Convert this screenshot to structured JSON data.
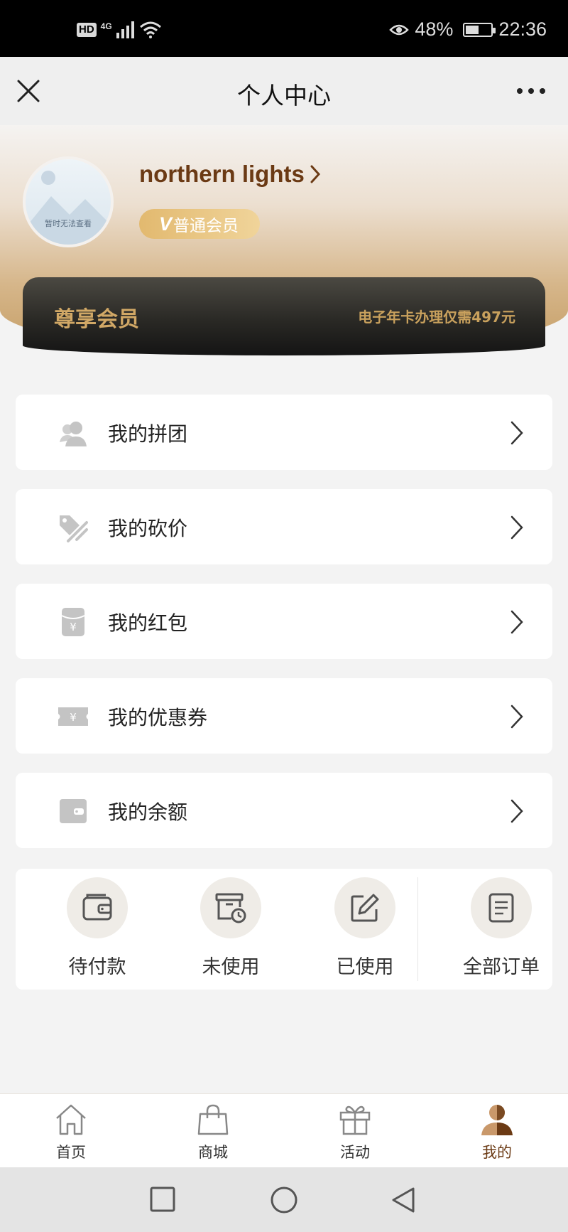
{
  "status_bar": {
    "hd": "HD",
    "network": "4G",
    "battery_percent": "48%",
    "battery_level": 0.48,
    "time": "22:36"
  },
  "nav": {
    "title": "个人中心",
    "close_icon": "close-icon",
    "more_icon": "more-icon"
  },
  "profile": {
    "avatar_placeholder": "暂时无法查看",
    "username": "northern lights",
    "member_level": "普通会员",
    "member_v": "V"
  },
  "vip_card": {
    "title": "尊享会员",
    "desc": "电子年卡办理仅需497元"
  },
  "menu": [
    {
      "label": "我的拼团",
      "icon": "group-user-icon"
    },
    {
      "label": "我的砍价",
      "icon": "bargain-tag-icon"
    },
    {
      "label": "我的红包",
      "icon": "red-packet-icon"
    },
    {
      "label": "我的优惠券",
      "icon": "coupon-icon"
    },
    {
      "label": "我的余额",
      "icon": "wallet-icon"
    }
  ],
  "orders": [
    {
      "label": "待付款",
      "icon": "wallet-icon"
    },
    {
      "label": "未使用",
      "icon": "box-clock-icon"
    },
    {
      "label": "已使用",
      "icon": "edit-icon"
    },
    {
      "label": "全部订单",
      "icon": "document-icon"
    }
  ],
  "tabs": [
    {
      "label": "首页",
      "icon": "home-icon"
    },
    {
      "label": "商城",
      "icon": "shopping-bag-icon"
    },
    {
      "label": "活动",
      "icon": "gift-icon"
    },
    {
      "label": "我的",
      "icon": "user-icon",
      "active": true
    }
  ],
  "colors": {
    "brand_brown": "#6b3a14",
    "gold": "#d1a866",
    "page_bg": "#f3f3f3"
  }
}
